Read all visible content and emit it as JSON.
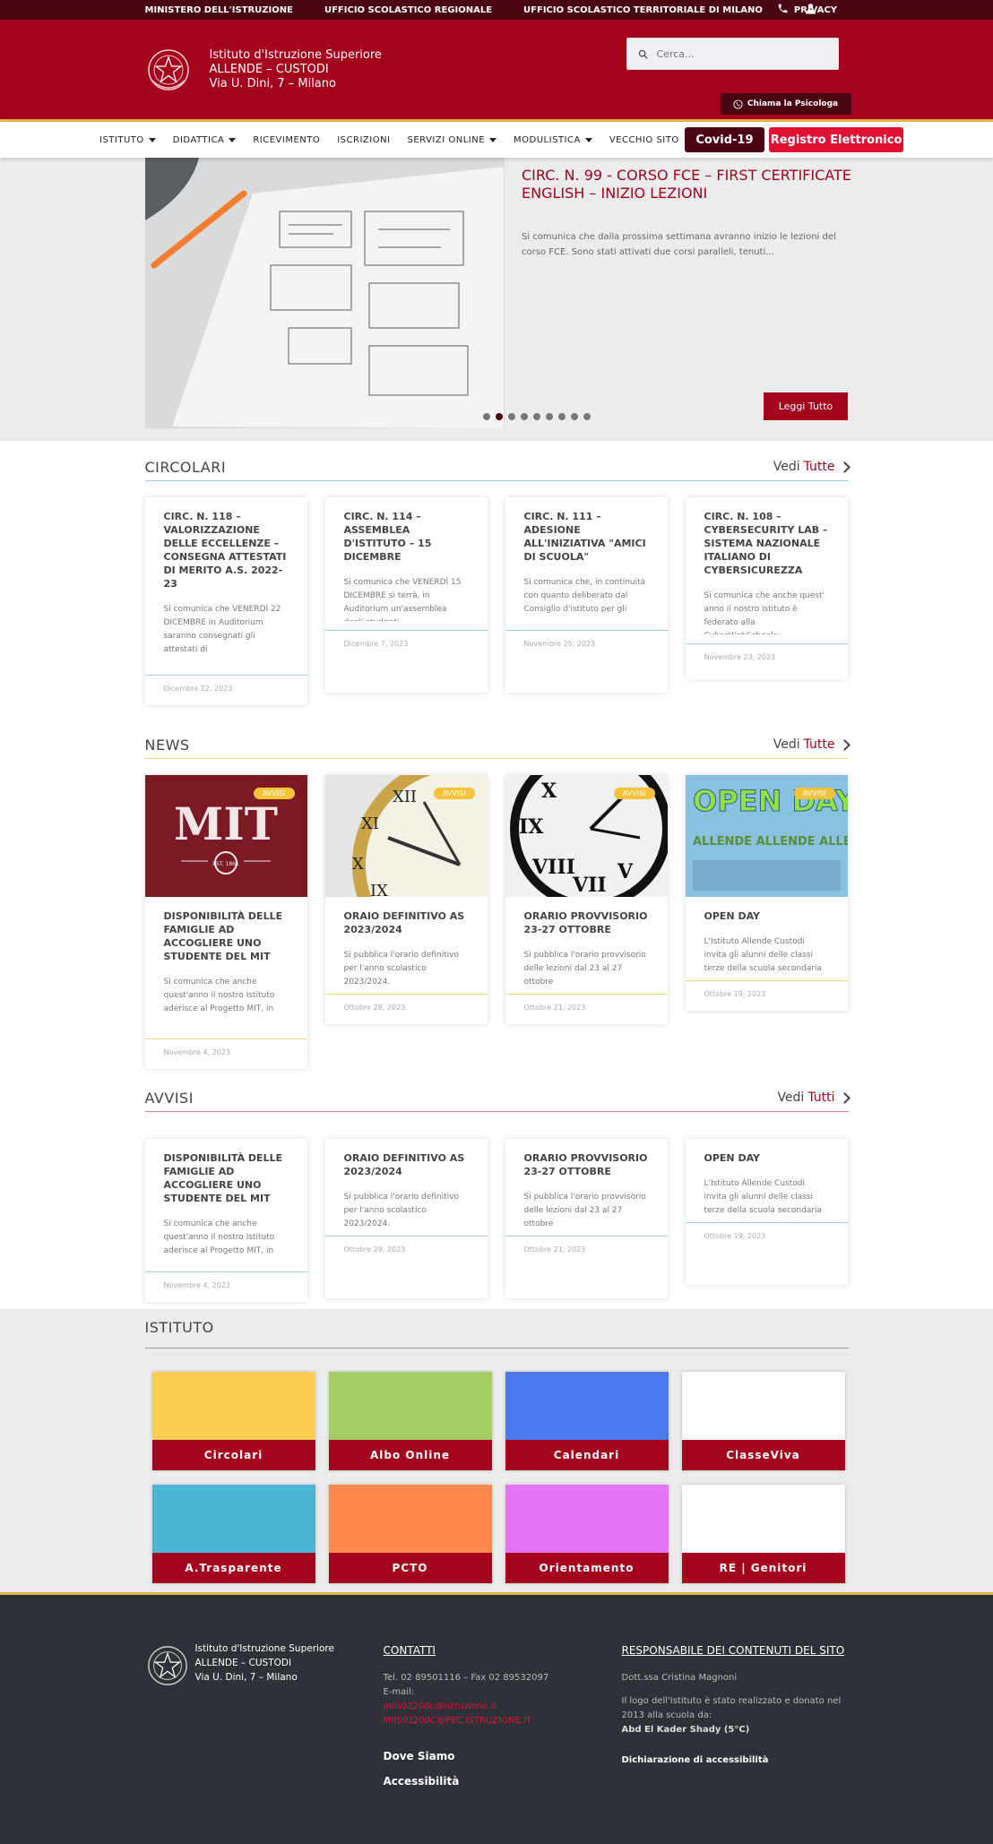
{
  "topbar": {
    "links": [
      "MINISTERO DELL'ISTRUZIONE",
      "UFFICIO SCOLASTICO REGIONALE",
      "UFFICIO SCOLASTICO TERRITORIALE DI MILANO",
      "PRIVACY"
    ],
    "icons": [
      "phone-icon",
      "user-icon"
    ]
  },
  "header": {
    "school_line1": "Istituto d'Istruzione Superiore",
    "school_line2": "ALLENDE – CUSTODI",
    "school_line3": "Via U. Dini, 7 –  Milano",
    "search_placeholder": "Cerca...",
    "psychologist_button": "Chiama la Psicologa"
  },
  "nav": {
    "items": [
      {
        "label": "ISTITUTO",
        "dropdown": true
      },
      {
        "label": "DIDATTICA",
        "dropdown": true
      },
      {
        "label": "RICEVIMENTO",
        "dropdown": false
      },
      {
        "label": "ISCRIZIONI",
        "dropdown": false
      },
      {
        "label": "SERVIZI ONLINE",
        "dropdown": true
      },
      {
        "label": "MODULISTICA",
        "dropdown": true
      },
      {
        "label": "VECCHIO SITO",
        "dropdown": false
      }
    ],
    "covid_button": "Covid-19",
    "register_button": "Registro Elettronico"
  },
  "slider": {
    "title": "CIRC. N. 99 - CORSO FCE – FIRST CERTIFICATE ENGLISH – INIZIO LEZIONI",
    "description": "Si comunica che dalla prossima settimana avranno inizio le lezioni del corso FCE. Sono stati attivati due corsi paralleli, tenuti...",
    "read_more": "Leggi Tutto",
    "dot_count": 9,
    "active_dot": 2
  },
  "circolari": {
    "title": "CIRCOLARI",
    "more_prefix": "Vedi",
    "more_highlight": "Tutte",
    "line_color": "#9fd4dc",
    "cards": [
      {
        "title": "CIRC. N. 118 – VALORIZZAZIONE DELLE ECCELLENZE – CONSEGNA ATTESTATI DI MERITO A.S. 2022-23",
        "text": "Si comunica che VENERDÌ 22 DICEMBRE in Auditorium saranno consegnati gli attestati di",
        "date": "Dicembre 12, 2023"
      },
      {
        "title": "CIRC. N. 114 – ASSEMBLEA D'ISTITUTO – 15 DICEMBRE",
        "text": "Si comunica che VENERDÌ 15 DICEMBRE si terrà, in Auditorium un'assemblea degli studenti.",
        "date": "Dicembre 7, 2023"
      },
      {
        "title": "CIRC. N. 111 – ADESIONE ALL'INIZIATIVA \"AMICI DI SCUOLA\"",
        "text": "Si comunica che, in continuità con quanto deliberato dal Consiglio d'istituto per gli",
        "date": "Novembre 25, 2023"
      },
      {
        "title": "CIRC. N. 108 – CYBERSECURITY LAB – SISTEMA NAZIONALE ITALIANO DI CYBERSICUREZZA",
        "text": "Si comunica che anche quest' anno il nostro istituto è federato alla CyberHighSchools,",
        "date": "Novembre 23, 2023"
      }
    ]
  },
  "news": {
    "title": "NEWS",
    "more_prefix": "Vedi",
    "more_highlight": "Tutte",
    "line_color": "#f0d880",
    "badge": "AVVISI",
    "cards": [
      {
        "title": "DISPONIBILITÀ DELLE FAMIGLIE AD ACCOGLIERE UNO STUDENTE DEL MIT",
        "text": "Si comunica che anche quest'anno  il nostro Istituto aderisce al Progetto MIT, in",
        "date": "Novembre 4, 2023",
        "image": "mit-logo-image",
        "image_text": "MIT",
        "image_sub": "EST.    1861"
      },
      {
        "title": "ORAIO DEFINITIVO AS 2023/2024",
        "text": "Si pubblica l'orario definitivo per l'anno scolastico 2023/2024.",
        "date": "Ottobre 28, 2023",
        "image": "clock-image"
      },
      {
        "title": "ORARIO PROVVISORIO 23-27 OTTOBRE",
        "text": "Si pubblica l'orario provvisorio delle lezioni dal 23 al 27 ottobre",
        "date": "Ottobre 21, 2023",
        "image": "wall-clock-image"
      },
      {
        "title": "OPEN DAY",
        "text": "L'Istituto Allende Custodi invita gli alunni delle classi terze della scuola secondaria di",
        "date": "Ottobre 19, 2023",
        "image": "open-day-image",
        "image_text": "OPEN DAY",
        "image_sub": "ALLENDE ALLENDE ALLENDE"
      }
    ]
  },
  "avvisi": {
    "title": "AVVISI",
    "more_prefix": "Vedi",
    "more_highlight": "Tutti",
    "line_color": "#e08090",
    "cards": [
      {
        "title": "DISPONIBILITÀ DELLE FAMIGLIE AD ACCOGLIERE UNO STUDENTE DEL MIT",
        "text": "Si comunica che anche quest'anno  il nostro Istituto aderisce al Progetto MIT, in",
        "date": "Novembre 4, 2023"
      },
      {
        "title": "ORAIO DEFINITIVO AS 2023/2024",
        "text": "Si pubblica l'orario definitivo per l'anno scolastico 2023/2024.",
        "date": "Ottobre 29, 2023"
      },
      {
        "title": "ORARIO PROVVISORIO 23-27 OTTOBRE",
        "text": "Si pubblica l'orario provvisorio delle lezioni dal 23 al 27 ottobre",
        "date": "Ottobre 21, 2023"
      },
      {
        "title": "OPEN DAY",
        "text": "L'Istituto Allende Custodi invita gli alunni delle classi terze della scuola secondaria di",
        "date": "Ottobre 19, 2023"
      }
    ]
  },
  "istituto": {
    "title": "ISTITUTO",
    "tiles": [
      {
        "label": "Circolari",
        "color": "#fccd55"
      },
      {
        "label": "Albo Online",
        "color": "#a4cd63"
      },
      {
        "label": "Calendari",
        "color": "#4c7aee"
      },
      {
        "label": "ClasseViva",
        "color": "#ffffff"
      },
      {
        "label": "A.Trasparente",
        "color": "#4cb5d6"
      },
      {
        "label": "PCTO",
        "color": "#fd8a4c"
      },
      {
        "label": "Orientamento",
        "color": "#e574f4"
      },
      {
        "label": "RE | Genitori",
        "color": "#ffffff"
      }
    ]
  },
  "footer": {
    "school_line1": "Istituto d'Istruzione Superiore",
    "school_line2": "ALLENDE – CUSTODI",
    "school_line3": "Via U. Dini, 7 –  Milano",
    "contacts_title": "CONTATTI",
    "phone": "Tel. 02 89501116 – Fax 02 89532097",
    "email_label": "E-mail:",
    "email1": "miis02200c@istruzione.it",
    "email2": "MIIS02200C@PEC.ISTRUZIONE.IT",
    "where": "Dove Siamo",
    "accessibility": "Accessibilità",
    "resp_title": "RESPONSABILE DEI CONTENUTI DEL SITO",
    "resp_name": "Dott.ssa Cristina Magnoni",
    "logo_note": "Il logo dell'Istituto è stato realizzato e donato nel 2013 alla scuola da:",
    "logo_author": "Abd El Kader Shady (5°C)",
    "accessibility_declaration": "Dichiarazione di accessibilità"
  }
}
